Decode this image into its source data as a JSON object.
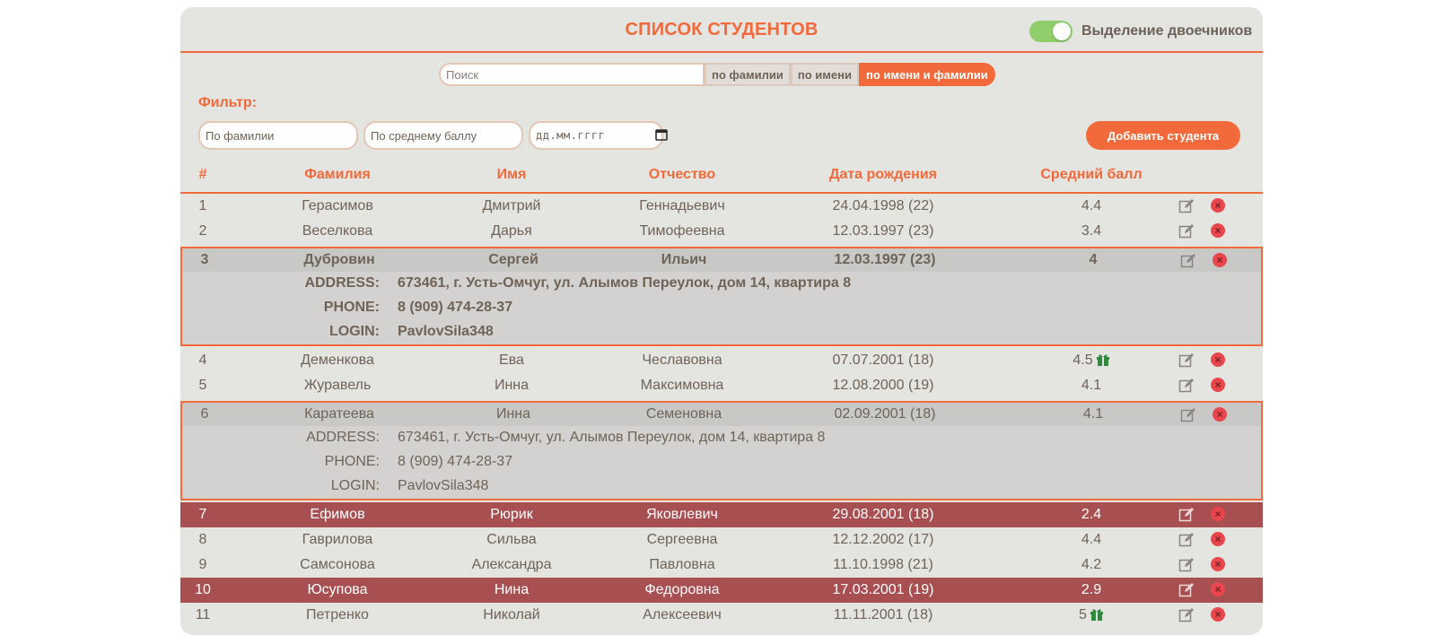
{
  "header": {
    "title": "СПИСОК СТУДЕНТОВ",
    "toggle_label": "Выделение двоечников",
    "toggle_on": true
  },
  "search": {
    "placeholder": "Поиск",
    "mode_buttons": [
      "по фамилии",
      "по имени",
      "по имени и фамилии"
    ],
    "active_mode": "по имени и фамилии"
  },
  "filter": {
    "label": "Фильтр:",
    "lastname_placeholder": "По фамилии",
    "grade_placeholder": "По среднему баллу",
    "date_placeholder": "дд.мм.гггг"
  },
  "add_button_label": "Добавить студента",
  "columns": [
    "#",
    "Фамилия",
    "Имя",
    "Отчество",
    "Дата рождения",
    "Средний балл"
  ],
  "detail_labels": {
    "address": "ADDRESS:",
    "phone": "PHONE:",
    "login": "LOGIN:"
  },
  "students": [
    {
      "num": "1",
      "last": "Герасимов",
      "first": "Дмитрий",
      "middle": "Геннадьевич",
      "birth": "24.04.1998 (22)",
      "grade": "4.4"
    },
    {
      "num": "2",
      "last": "Веселкова",
      "first": "Дарья",
      "middle": "Тимофеевна",
      "birth": "12.03.1997 (23)",
      "grade": "3.4"
    },
    {
      "num": "3",
      "last": "Дубровин",
      "first": "Сергей",
      "middle": "Ильич",
      "birth": "12.03.1997 (23)",
      "grade": "4",
      "expanded": true,
      "selected": true,
      "address": "673461, г. Усть-Омчуг, ул. Алымов Переулок, дом 14, квартира 8",
      "phone": "8 (909) 474-28-37",
      "login": "PavlovSila348"
    },
    {
      "num": "4",
      "last": "Деменкова",
      "first": "Ева",
      "middle": "Чеславовна",
      "birth": "07.07.2001 (18)",
      "grade": "4.5",
      "gift": true
    },
    {
      "num": "5",
      "last": "Журавель",
      "first": "Инна",
      "middle": "Максимовна",
      "birth": "12.08.2000 (19)",
      "grade": "4.1"
    },
    {
      "num": "6",
      "last": "Каратеева",
      "first": "Инна",
      "middle": "Семеновна",
      "birth": "02.09.2001 (18)",
      "grade": "4.1",
      "expanded": true,
      "address": "673461, г. Усть-Омчуг, ул. Алымов Переулок, дом 14, квартира 8",
      "phone": "8 (909) 474-28-37",
      "login": "PavlovSila348"
    },
    {
      "num": "7",
      "last": "Ефимов",
      "first": "Рюрик",
      "middle": "Яковлевич",
      "birth": "29.08.2001 (18)",
      "grade": "2.4",
      "failing": true
    },
    {
      "num": "8",
      "last": "Гаврилова",
      "first": "Сильва",
      "middle": "Сергеевна",
      "birth": "12.12.2002 (17)",
      "grade": "4.4"
    },
    {
      "num": "9",
      "last": "Самсонова",
      "first": "Александра",
      "middle": "Павловна",
      "birth": "11.10.1998 (21)",
      "grade": "4.2"
    },
    {
      "num": "10",
      "last": "Юсупова",
      "first": "Нина",
      "middle": "Федоровна",
      "birth": "17.03.2001 (19)",
      "grade": "2.9",
      "failing": true
    },
    {
      "num": "11",
      "last": "Петренко",
      "first": "Николай",
      "middle": "Алексеевич",
      "birth": "11.11.2001 (18)",
      "grade": "5",
      "gift": true
    }
  ],
  "colors": {
    "accent": "#f26a3c",
    "failing_row": "#a84f51",
    "panel": "#e4e4e1",
    "toggle_on": "#8fce6a",
    "gift": "#2e8b3e",
    "delete": "#e8474d"
  },
  "icons": {
    "edit": "edit-icon",
    "delete": "delete-icon",
    "gift": "gift-icon",
    "calendar": "calendar-icon"
  }
}
